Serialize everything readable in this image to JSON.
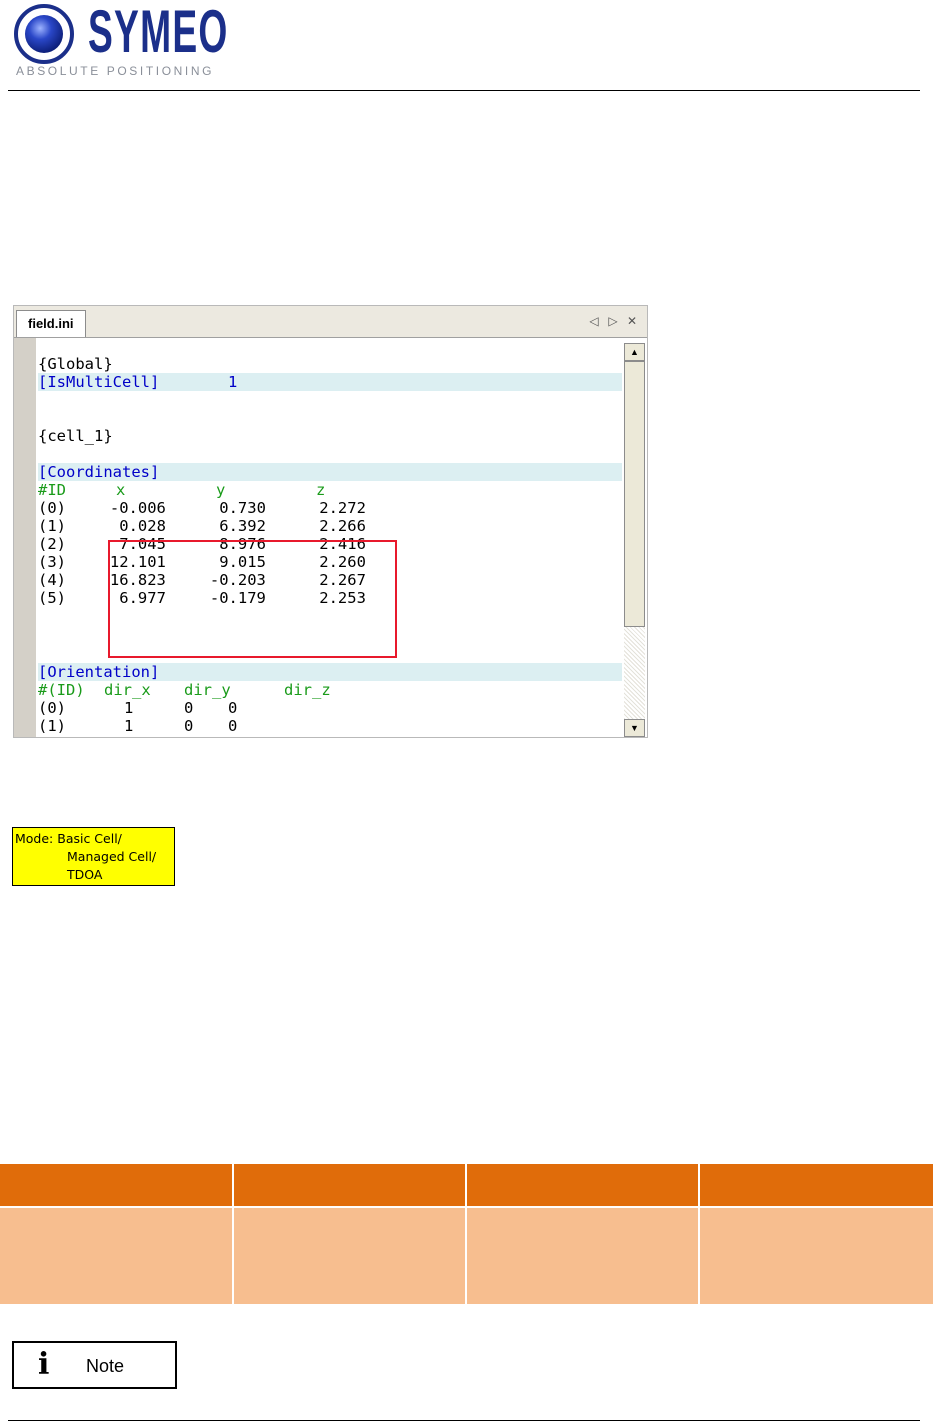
{
  "logo": {
    "wordmark": "SYMEO",
    "tagline": "ABSOLUTE POSITIONING",
    "colors": {
      "mark": "#1b2f8a",
      "tagline": "#8a8f99"
    }
  },
  "editor": {
    "tab_label": "field.ini",
    "controls": {
      "prev": "◁",
      "next": "▷",
      "close": "✕"
    },
    "scroll_up": "▲",
    "scroll_down": "▼",
    "colors": {
      "section": "#0000c8",
      "comment": "#1a9b1a",
      "highlight": "#dceff2",
      "selection_box": "#e8192c"
    },
    "lines": {
      "global": "{Global}",
      "ismulticell_key": "[IsMultiCell]",
      "ismulticell_value": "1",
      "cell": "{cell_1}",
      "coordinates": "[Coordinates]",
      "coord_header": {
        "id": "#ID",
        "x": "x",
        "y": "y",
        "z": "z"
      },
      "coord_rows": [
        {
          "id": "(0)",
          "x": "-0.006",
          "y": "0.730",
          "z": "2.272"
        },
        {
          "id": "(1)",
          "x": "0.028",
          "y": "6.392",
          "z": "2.266"
        },
        {
          "id": "(2)",
          "x": "7.045",
          "y": "8.976",
          "z": "2.416"
        },
        {
          "id": "(3)",
          "x": "12.101",
          "y": "9.015",
          "z": "2.260"
        },
        {
          "id": "(4)",
          "x": "16.823",
          "y": "-0.203",
          "z": "2.267"
        },
        {
          "id": "(5)",
          "x": "6.977",
          "y": "-0.179",
          "z": "2.253"
        }
      ],
      "orientation": "[Orientation]",
      "orient_header": {
        "id": "#(ID)",
        "dir_x": "dir_x",
        "dir_y": "dir_y",
        "dir_z": "dir_z"
      },
      "orient_rows": [
        {
          "id": "(0)",
          "dir_x": "1",
          "dir_y": "0",
          "dir_z": "0"
        },
        {
          "id": "(1)",
          "dir_x": "1",
          "dir_y": "0",
          "dir_z": "0"
        }
      ]
    }
  },
  "mode_badge": {
    "line1": "Mode: Basic Cell/",
    "line2": "Managed Cell/",
    "line3": "TDOA",
    "color": "#ffff00"
  },
  "table": {
    "header_color": "#e06c0a",
    "body_color": "#f7be8f"
  },
  "note": {
    "icon": "i",
    "label": "Note"
  }
}
